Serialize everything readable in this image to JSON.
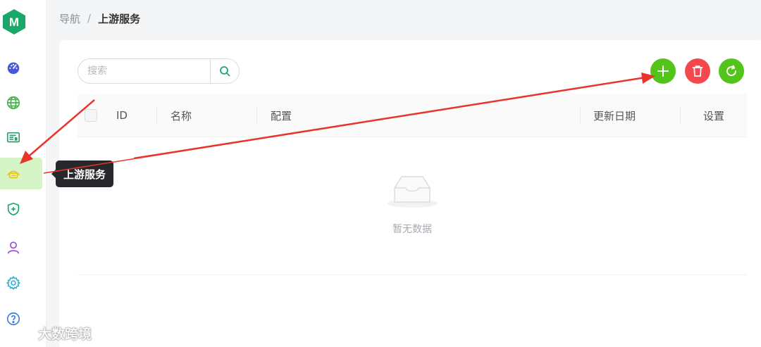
{
  "logo": {
    "letter": "M",
    "color": "#1aa86a"
  },
  "sidebar": {
    "items": [
      {
        "id": "dashboard",
        "icon": "gauge-icon",
        "color": "#4657d9"
      },
      {
        "id": "routes",
        "icon": "globe-icon",
        "color": "#46b04a"
      },
      {
        "id": "services",
        "icon": "server-list-icon",
        "color": "#2d9b6f"
      },
      {
        "id": "upstream",
        "icon": "upstream-icon",
        "color": "#f2c215",
        "active": true
      },
      {
        "id": "plugins",
        "icon": "shield-plus-icon",
        "color": "#1aa86a"
      },
      {
        "id": "consumers",
        "icon": "user-icon",
        "color": "#9b4dd6"
      },
      {
        "id": "settings",
        "icon": "gear-icon",
        "color": "#3aaed8"
      },
      {
        "id": "help",
        "icon": "help-circle-icon",
        "color": "#3a7fd8"
      }
    ]
  },
  "tooltip": {
    "text": "上游服务"
  },
  "breadcrumb": {
    "root": "导航",
    "separator": "/",
    "current": "上游服务"
  },
  "search": {
    "placeholder": "搜索",
    "value": ""
  },
  "actions": {
    "add_color": "#52c41a",
    "delete_color": "#f5484d",
    "refresh_color": "#52c41a"
  },
  "table": {
    "columns": [
      "ID",
      "名称",
      "配置",
      "更新日期",
      "设置"
    ],
    "rows": [],
    "empty_text": "暂无数据"
  },
  "watermark": {
    "text": "大数跨境"
  },
  "annotation": {
    "arrow_color": "#e8342a"
  }
}
